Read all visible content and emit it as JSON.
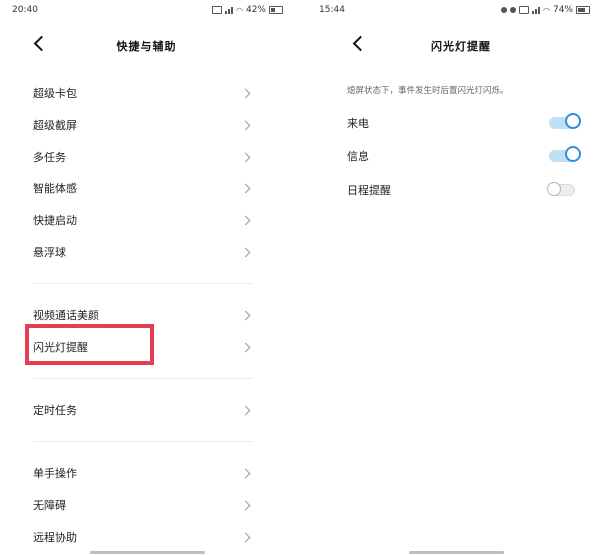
{
  "left_screen": {
    "status": {
      "time": "20:40",
      "battery": "42%"
    },
    "title": "快捷与辅助",
    "items": [
      {
        "label": "超级卡包"
      },
      {
        "label": "超级截屏"
      },
      {
        "label": "多任务"
      },
      {
        "label": "智能体感"
      },
      {
        "label": "快捷启动"
      },
      {
        "label": "悬浮球"
      },
      {
        "label": "视频通话美颜"
      },
      {
        "label": "闪光灯提醒"
      },
      {
        "label": "定时任务"
      },
      {
        "label": "单手操作"
      },
      {
        "label": "无障碍"
      },
      {
        "label": "远程协助"
      }
    ]
  },
  "right_screen": {
    "status": {
      "time": "15:44",
      "battery": "74%"
    },
    "title": "闪光灯提醒",
    "description": "熄屏状态下，事件发生时后置闪光灯闪烁。",
    "settings": [
      {
        "label": "来电",
        "enabled": true
      },
      {
        "label": "信息",
        "enabled": true
      },
      {
        "label": "日程提醒",
        "enabled": false
      }
    ]
  },
  "colors": {
    "accent": "#2f8fdd",
    "highlight": "#e43d55"
  }
}
